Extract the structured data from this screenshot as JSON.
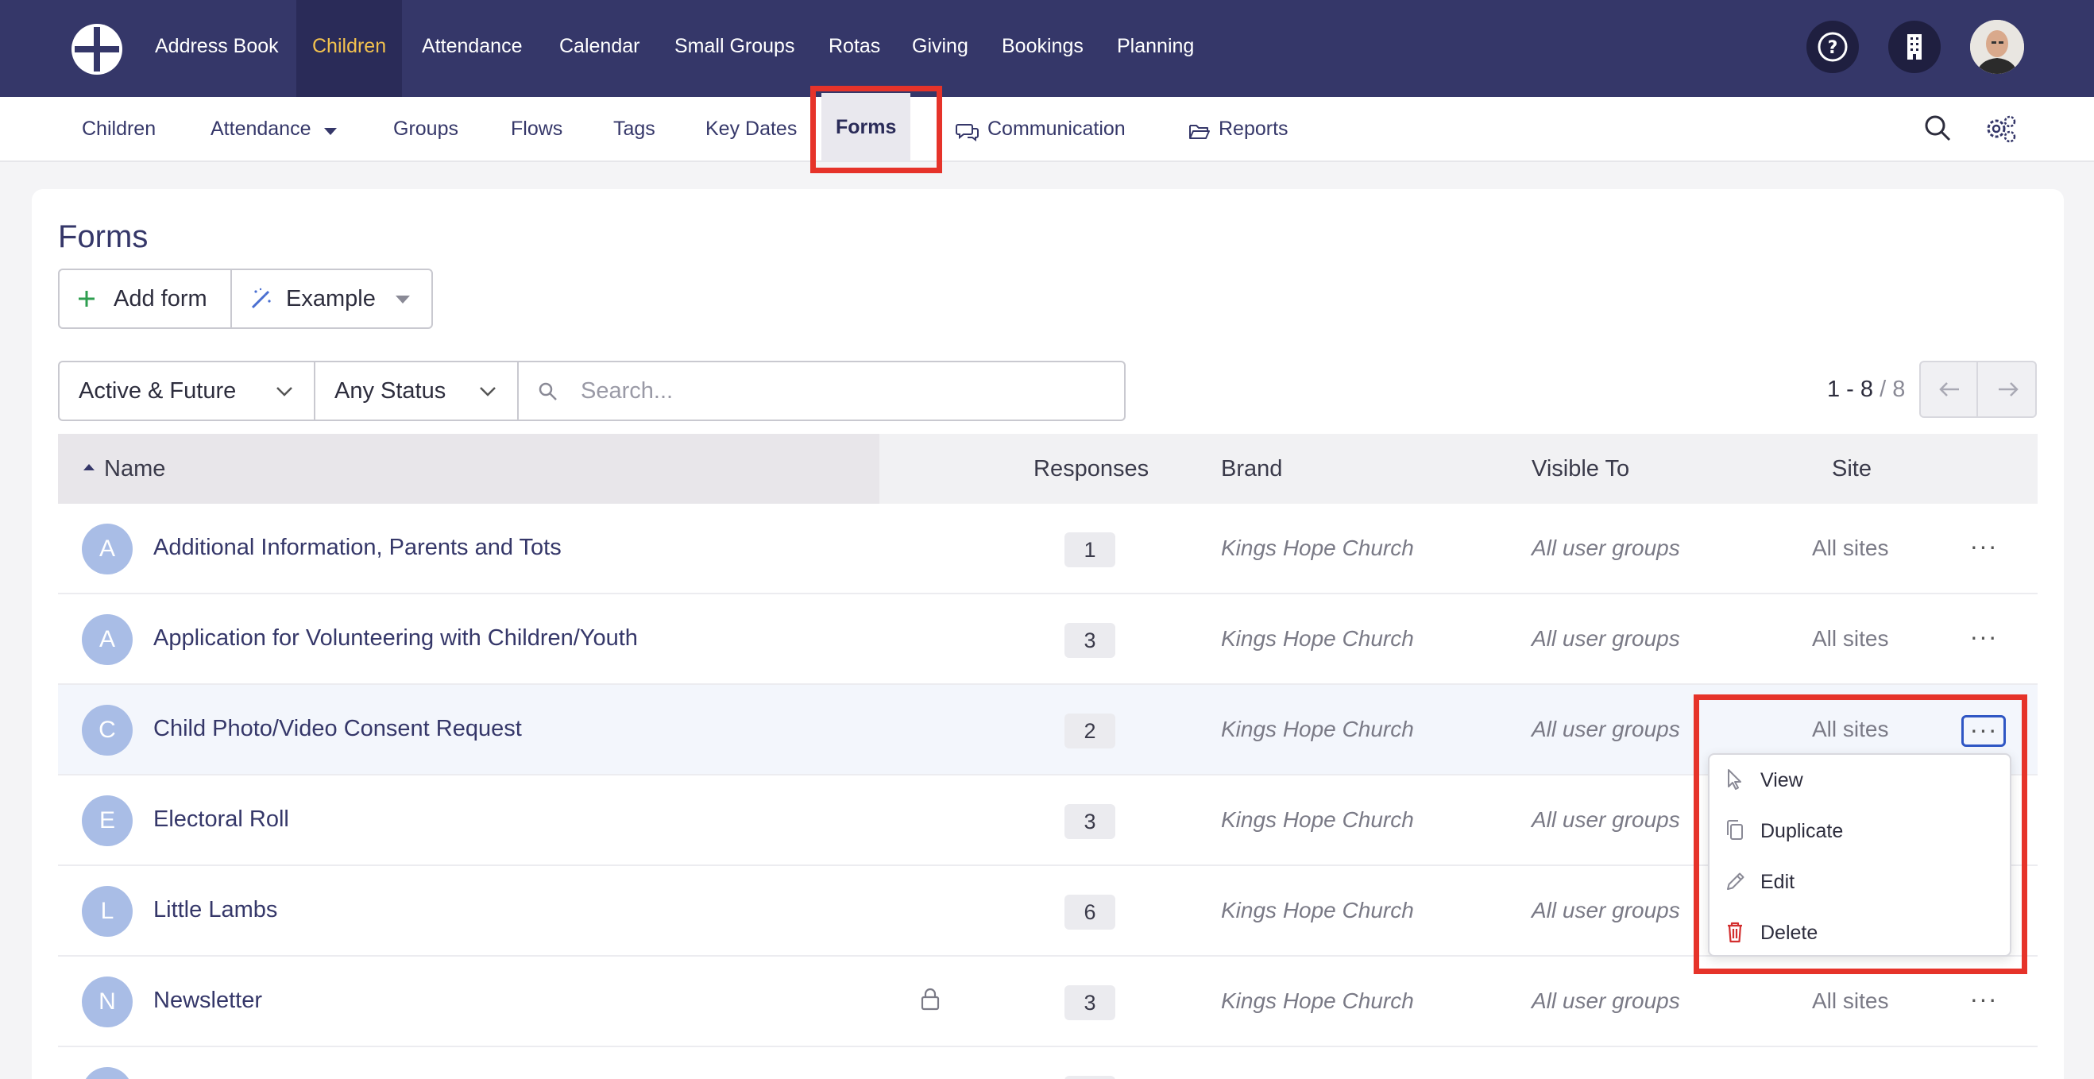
{
  "topnav": {
    "items": [
      "Address Book",
      "Children",
      "Attendance",
      "Calendar",
      "Small Groups",
      "Rotas",
      "Giving",
      "Bookings",
      "Planning"
    ],
    "active": "Children",
    "icons": [
      "help-icon",
      "building-icon",
      "avatar"
    ]
  },
  "subnav": {
    "items": [
      "Children",
      "Attendance",
      "Groups",
      "Flows",
      "Tags",
      "Key Dates",
      "Forms",
      "Communication",
      "Reports"
    ],
    "active": "Forms"
  },
  "page": {
    "title": "Forms",
    "add_button": "Add form",
    "example_button": "Example"
  },
  "filters": {
    "date": "Active & Future",
    "status": "Any Status",
    "search_placeholder": "Search..."
  },
  "pager": {
    "range": "1 - 8",
    "total": "/ 8"
  },
  "table": {
    "headers": {
      "name": "Name",
      "responses": "Responses",
      "brand": "Brand",
      "visible": "Visible To",
      "site": "Site"
    },
    "rows": [
      {
        "initial": "A",
        "name": "Additional Information, Parents and Tots",
        "responses": "1",
        "brand": "Kings Hope Church",
        "visible": "All user groups",
        "site": "All sites"
      },
      {
        "initial": "A",
        "name": "Application for Volunteering with Children/Youth",
        "responses": "3",
        "brand": "Kings Hope Church",
        "visible": "All user groups",
        "site": "All sites"
      },
      {
        "initial": "C",
        "name": "Child Photo/Video Consent Request",
        "responses": "2",
        "brand": "Kings Hope Church",
        "visible": "All user groups",
        "site": "All sites"
      },
      {
        "initial": "E",
        "name": "Electoral Roll",
        "responses": "3",
        "brand": "Kings Hope Church",
        "visible": "All user groups",
        "site": ""
      },
      {
        "initial": "L",
        "name": "Little Lambs",
        "responses": "6",
        "brand": "Kings Hope Church",
        "visible": "All user groups",
        "site": ""
      },
      {
        "initial": "N",
        "name": "Newsletter",
        "responses": "3",
        "brand": "Kings Hope Church",
        "visible": "All user groups",
        "site": "All sites"
      }
    ]
  },
  "menu": {
    "items": [
      "View",
      "Duplicate",
      "Edit",
      "Delete"
    ]
  },
  "colors": {
    "nav_bg": "#353769",
    "active_text": "#f2c14e",
    "highlight": "#e6332a",
    "delete": "#d32f2f"
  }
}
